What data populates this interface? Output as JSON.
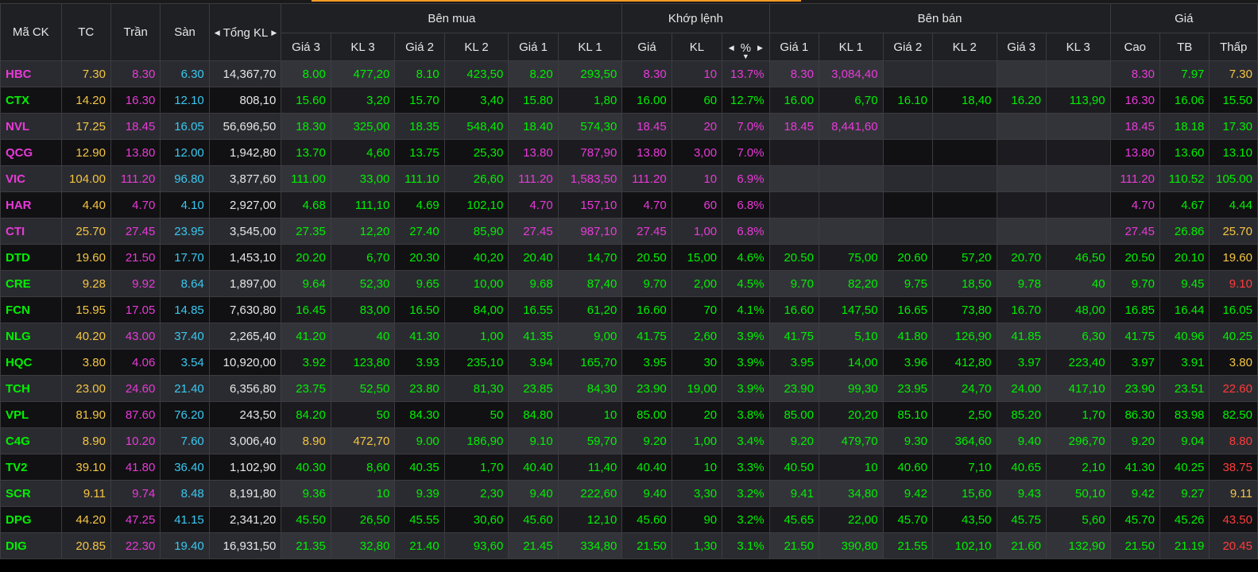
{
  "colors": {
    "ref": "#f5c542",
    "ceiling": "#e83ad8",
    "floor": "#39c8f0",
    "up": "#00f000",
    "down": "#ff3b3b",
    "neutral": "#e6e6e6"
  },
  "header": {
    "symbol": "Mã CK",
    "ref": "TC",
    "ceiling": "Trần",
    "floor": "Sàn",
    "total_volume": "Tổng KL",
    "buy_side": "Bên mua",
    "matched": "Khớp lệnh",
    "sell_side": "Bên bán",
    "price_group": "Giá",
    "bid3": "Giá 3",
    "bid3_vol": "KL 3",
    "bid2": "Giá 2",
    "bid2_vol": "KL 2",
    "bid1": "Giá 1",
    "bid1_vol": "KL 1",
    "match_price": "Giá",
    "match_vol": "KL",
    "match_pct": "%",
    "ask1": "Giá 1",
    "ask1_vol": "KL 1",
    "ask2": "Giá 2",
    "ask2_vol": "KL 2",
    "ask3": "Giá 3",
    "ask3_vol": "KL 3",
    "high": "Cao",
    "avg": "TB",
    "low": "Thấp"
  },
  "rows": [
    {
      "sym": "HBC",
      "tc": "7.30",
      "tran": "8.30",
      "san": "6.30",
      "tkl": "14,367,70",
      "g3": "8.00",
      "kl3": "477,20",
      "g2": "8.10",
      "kl2": "423,50",
      "g1": "8.20",
      "kl1": "293,50",
      "mp": "8.30",
      "mv": "10",
      "pct": "13.7%",
      "a1": "8.30",
      "av1": "3,084,40",
      "a2": "",
      "av2": "",
      "a3": "",
      "av3": "",
      "cao": "8.30",
      "tb": "7.97",
      "thap": "7.30",
      "c": {
        "sym": "ceiling",
        "g3": "up",
        "kl3": "up",
        "g2": "up",
        "kl2": "up",
        "g1": "up",
        "kl1": "up",
        "mp": "ceiling",
        "mv": "ceiling",
        "pct": "ceiling",
        "a1": "ceiling",
        "av1": "ceiling",
        "a2": "up",
        "av2": "up",
        "a3": "up",
        "av3": "up",
        "cao": "ceiling",
        "tb": "up",
        "thap": "ref"
      }
    },
    {
      "sym": "CTX",
      "tc": "14.20",
      "tran": "16.30",
      "san": "12.10",
      "tkl": "808,10",
      "g3": "15.60",
      "kl3": "3,20",
      "g2": "15.70",
      "kl2": "3,40",
      "g1": "15.80",
      "kl1": "1,80",
      "mp": "16.00",
      "mv": "60",
      "pct": "12.7%",
      "a1": "16.00",
      "av1": "6,70",
      "a2": "16.10",
      "av2": "18,40",
      "a3": "16.20",
      "av3": "113,90",
      "cao": "16.30",
      "tb": "16.06",
      "thap": "15.50",
      "c": {
        "sym": "up",
        "g3": "up",
        "kl3": "up",
        "g2": "up",
        "kl2": "up",
        "g1": "up",
        "kl1": "up",
        "mp": "up",
        "mv": "up",
        "pct": "up",
        "a1": "up",
        "av1": "up",
        "a2": "up",
        "av2": "up",
        "a3": "up",
        "av3": "up",
        "cao": "ceiling",
        "tb": "up",
        "thap": "up"
      }
    },
    {
      "sym": "NVL",
      "tc": "17.25",
      "tran": "18.45",
      "san": "16.05",
      "tkl": "56,696,50",
      "g3": "18.30",
      "kl3": "325,00",
      "g2": "18.35",
      "kl2": "548,40",
      "g1": "18.40",
      "kl1": "574,30",
      "mp": "18.45",
      "mv": "20",
      "pct": "7.0%",
      "a1": "18.45",
      "av1": "8,441,60",
      "a2": "",
      "av2": "",
      "a3": "",
      "av3": "",
      "cao": "18.45",
      "tb": "18.18",
      "thap": "17.30",
      "c": {
        "sym": "ceiling",
        "g3": "up",
        "kl3": "up",
        "g2": "up",
        "kl2": "up",
        "g1": "up",
        "kl1": "up",
        "mp": "ceiling",
        "mv": "ceiling",
        "pct": "ceiling",
        "a1": "ceiling",
        "av1": "ceiling",
        "a2": "up",
        "av2": "up",
        "a3": "up",
        "av3": "up",
        "cao": "ceiling",
        "tb": "up",
        "thap": "up"
      }
    },
    {
      "sym": "QCG",
      "tc": "12.90",
      "tran": "13.80",
      "san": "12.00",
      "tkl": "1,942,80",
      "g3": "13.70",
      "kl3": "4,60",
      "g2": "13.75",
      "kl2": "25,30",
      "g1": "13.80",
      "kl1": "787,90",
      "mp": "13.80",
      "mv": "3,00",
      "pct": "7.0%",
      "a1": "",
      "av1": "",
      "a2": "",
      "av2": "",
      "a3": "",
      "av3": "",
      "cao": "13.80",
      "tb": "13.60",
      "thap": "13.10",
      "c": {
        "sym": "ceiling",
        "g3": "up",
        "kl3": "up",
        "g2": "up",
        "kl2": "up",
        "g1": "ceiling",
        "kl1": "ceiling",
        "mp": "ceiling",
        "mv": "ceiling",
        "pct": "ceiling",
        "a1": "up",
        "av1": "up",
        "a2": "up",
        "av2": "up",
        "a3": "up",
        "av3": "up",
        "cao": "ceiling",
        "tb": "up",
        "thap": "up"
      }
    },
    {
      "sym": "VIC",
      "tc": "104.00",
      "tran": "111.20",
      "san": "96.80",
      "tkl": "3,877,60",
      "g3": "111.00",
      "kl3": "33,00",
      "g2": "111.10",
      "kl2": "26,60",
      "g1": "111.20",
      "kl1": "1,583,50",
      "mp": "111.20",
      "mv": "10",
      "pct": "6.9%",
      "a1": "",
      "av1": "",
      "a2": "",
      "av2": "",
      "a3": "",
      "av3": "",
      "cao": "111.20",
      "tb": "110.52",
      "thap": "105.00",
      "c": {
        "sym": "ceiling",
        "g3": "up",
        "kl3": "up",
        "g2": "up",
        "kl2": "up",
        "g1": "ceiling",
        "kl1": "ceiling",
        "mp": "ceiling",
        "mv": "ceiling",
        "pct": "ceiling",
        "a1": "up",
        "av1": "up",
        "a2": "up",
        "av2": "up",
        "a3": "up",
        "av3": "up",
        "cao": "ceiling",
        "tb": "up",
        "thap": "up"
      }
    },
    {
      "sym": "HAR",
      "tc": "4.40",
      "tran": "4.70",
      "san": "4.10",
      "tkl": "2,927,00",
      "g3": "4.68",
      "kl3": "111,10",
      "g2": "4.69",
      "kl2": "102,10",
      "g1": "4.70",
      "kl1": "157,10",
      "mp": "4.70",
      "mv": "60",
      "pct": "6.8%",
      "a1": "",
      "av1": "",
      "a2": "",
      "av2": "",
      "a3": "",
      "av3": "",
      "cao": "4.70",
      "tb": "4.67",
      "thap": "4.44",
      "c": {
        "sym": "ceiling",
        "g3": "up",
        "kl3": "up",
        "g2": "up",
        "kl2": "up",
        "g1": "ceiling",
        "kl1": "ceiling",
        "mp": "ceiling",
        "mv": "ceiling",
        "pct": "ceiling",
        "a1": "up",
        "av1": "up",
        "a2": "up",
        "av2": "up",
        "a3": "up",
        "av3": "up",
        "cao": "ceiling",
        "tb": "up",
        "thap": "up"
      }
    },
    {
      "sym": "CTI",
      "tc": "25.70",
      "tran": "27.45",
      "san": "23.95",
      "tkl": "3,545,00",
      "g3": "27.35",
      "kl3": "12,20",
      "g2": "27.40",
      "kl2": "85,90",
      "g1": "27.45",
      "kl1": "987,10",
      "mp": "27.45",
      "mv": "1,00",
      "pct": "6.8%",
      "a1": "",
      "av1": "",
      "a2": "",
      "av2": "",
      "a3": "",
      "av3": "",
      "cao": "27.45",
      "tb": "26.86",
      "thap": "25.70",
      "c": {
        "sym": "ceiling",
        "g3": "up",
        "kl3": "up",
        "g2": "up",
        "kl2": "up",
        "g1": "ceiling",
        "kl1": "ceiling",
        "mp": "ceiling",
        "mv": "ceiling",
        "pct": "ceiling",
        "a1": "up",
        "av1": "up",
        "a2": "up",
        "av2": "up",
        "a3": "up",
        "av3": "up",
        "cao": "ceiling",
        "tb": "up",
        "thap": "ref"
      }
    },
    {
      "sym": "DTD",
      "tc": "19.60",
      "tran": "21.50",
      "san": "17.70",
      "tkl": "1,453,10",
      "g3": "20.20",
      "kl3": "6,70",
      "g2": "20.30",
      "kl2": "40,20",
      "g1": "20.40",
      "kl1": "14,70",
      "mp": "20.50",
      "mv": "15,00",
      "pct": "4.6%",
      "a1": "20.50",
      "av1": "75,00",
      "a2": "20.60",
      "av2": "57,20",
      "a3": "20.70",
      "av3": "46,50",
      "cao": "20.50",
      "tb": "20.10",
      "thap": "19.60",
      "c": {
        "sym": "up",
        "g3": "up",
        "kl3": "up",
        "g2": "up",
        "kl2": "up",
        "g1": "up",
        "kl1": "up",
        "mp": "up",
        "mv": "up",
        "pct": "up",
        "a1": "up",
        "av1": "up",
        "a2": "up",
        "av2": "up",
        "a3": "up",
        "av3": "up",
        "cao": "up",
        "tb": "up",
        "thap": "ref"
      }
    },
    {
      "sym": "CRE",
      "tc": "9.28",
      "tran": "9.92",
      "san": "8.64",
      "tkl": "1,897,00",
      "g3": "9.64",
      "kl3": "52,30",
      "g2": "9.65",
      "kl2": "10,00",
      "g1": "9.68",
      "kl1": "87,40",
      "mp": "9.70",
      "mv": "2,00",
      "pct": "4.5%",
      "a1": "9.70",
      "av1": "82,20",
      "a2": "9.75",
      "av2": "18,50",
      "a3": "9.78",
      "av3": "40",
      "cao": "9.70",
      "tb": "9.45",
      "thap": "9.10",
      "c": {
        "sym": "up",
        "g3": "up",
        "kl3": "up",
        "g2": "up",
        "kl2": "up",
        "g1": "up",
        "kl1": "up",
        "mp": "up",
        "mv": "up",
        "pct": "up",
        "a1": "up",
        "av1": "up",
        "a2": "up",
        "av2": "up",
        "a3": "up",
        "av3": "up",
        "cao": "up",
        "tb": "up",
        "thap": "down"
      }
    },
    {
      "sym": "FCN",
      "tc": "15.95",
      "tran": "17.05",
      "san": "14.85",
      "tkl": "7,630,80",
      "g3": "16.45",
      "kl3": "83,00",
      "g2": "16.50",
      "kl2": "84,00",
      "g1": "16.55",
      "kl1": "61,20",
      "mp": "16.60",
      "mv": "70",
      "pct": "4.1%",
      "a1": "16.60",
      "av1": "147,50",
      "a2": "16.65",
      "av2": "73,80",
      "a3": "16.70",
      "av3": "48,00",
      "cao": "16.85",
      "tb": "16.44",
      "thap": "16.05",
      "c": {
        "sym": "up",
        "g3": "up",
        "kl3": "up",
        "g2": "up",
        "kl2": "up",
        "g1": "up",
        "kl1": "up",
        "mp": "up",
        "mv": "up",
        "pct": "up",
        "a1": "up",
        "av1": "up",
        "a2": "up",
        "av2": "up",
        "a3": "up",
        "av3": "up",
        "cao": "up",
        "tb": "up",
        "thap": "up"
      }
    },
    {
      "sym": "NLG",
      "tc": "40.20",
      "tran": "43.00",
      "san": "37.40",
      "tkl": "2,265,40",
      "g3": "41.20",
      "kl3": "40",
      "g2": "41.30",
      "kl2": "1,00",
      "g1": "41.35",
      "kl1": "9,00",
      "mp": "41.75",
      "mv": "2,60",
      "pct": "3.9%",
      "a1": "41.75",
      "av1": "5,10",
      "a2": "41.80",
      "av2": "126,90",
      "a3": "41.85",
      "av3": "6,30",
      "cao": "41.75",
      "tb": "40.96",
      "thap": "40.25",
      "c": {
        "sym": "up",
        "g3": "up",
        "kl3": "up",
        "g2": "up",
        "kl2": "up",
        "g1": "up",
        "kl1": "up",
        "mp": "up",
        "mv": "up",
        "pct": "up",
        "a1": "up",
        "av1": "up",
        "a2": "up",
        "av2": "up",
        "a3": "up",
        "av3": "up",
        "cao": "up",
        "tb": "up",
        "thap": "up"
      }
    },
    {
      "sym": "HQC",
      "tc": "3.80",
      "tran": "4.06",
      "san": "3.54",
      "tkl": "10,920,00",
      "g3": "3.92",
      "kl3": "123,80",
      "g2": "3.93",
      "kl2": "235,10",
      "g1": "3.94",
      "kl1": "165,70",
      "mp": "3.95",
      "mv": "30",
      "pct": "3.9%",
      "a1": "3.95",
      "av1": "14,00",
      "a2": "3.96",
      "av2": "412,80",
      "a3": "3.97",
      "av3": "223,40",
      "cao": "3.97",
      "tb": "3.91",
      "thap": "3.80",
      "c": {
        "sym": "up",
        "g3": "up",
        "kl3": "up",
        "g2": "up",
        "kl2": "up",
        "g1": "up",
        "kl1": "up",
        "mp": "up",
        "mv": "up",
        "pct": "up",
        "a1": "up",
        "av1": "up",
        "a2": "up",
        "av2": "up",
        "a3": "up",
        "av3": "up",
        "cao": "up",
        "tb": "up",
        "thap": "ref"
      }
    },
    {
      "sym": "TCH",
      "tc": "23.00",
      "tran": "24.60",
      "san": "21.40",
      "tkl": "6,356,80",
      "g3": "23.75",
      "kl3": "52,50",
      "g2": "23.80",
      "kl2": "81,30",
      "g1": "23.85",
      "kl1": "84,30",
      "mp": "23.90",
      "mv": "19,00",
      "pct": "3.9%",
      "a1": "23.90",
      "av1": "99,30",
      "a2": "23.95",
      "av2": "24,70",
      "a3": "24.00",
      "av3": "417,10",
      "cao": "23.90",
      "tb": "23.51",
      "thap": "22.60",
      "c": {
        "sym": "up",
        "g3": "up",
        "kl3": "up",
        "g2": "up",
        "kl2": "up",
        "g1": "up",
        "kl1": "up",
        "mp": "up",
        "mv": "up",
        "pct": "up",
        "a1": "up",
        "av1": "up",
        "a2": "up",
        "av2": "up",
        "a3": "up",
        "av3": "up",
        "cao": "up",
        "tb": "up",
        "thap": "down"
      }
    },
    {
      "sym": "VPL",
      "tc": "81.90",
      "tran": "87.60",
      "san": "76.20",
      "tkl": "243,50",
      "g3": "84.20",
      "kl3": "50",
      "g2": "84.30",
      "kl2": "50",
      "g1": "84.80",
      "kl1": "10",
      "mp": "85.00",
      "mv": "20",
      "pct": "3.8%",
      "a1": "85.00",
      "av1": "20,20",
      "a2": "85.10",
      "av2": "2,50",
      "a3": "85.20",
      "av3": "1,70",
      "cao": "86.30",
      "tb": "83.98",
      "thap": "82.50",
      "c": {
        "sym": "up",
        "g3": "up",
        "kl3": "up",
        "g2": "up",
        "kl2": "up",
        "g1": "up",
        "kl1": "up",
        "mp": "up",
        "mv": "up",
        "pct": "up",
        "a1": "up",
        "av1": "up",
        "a2": "up",
        "av2": "up",
        "a3": "up",
        "av3": "up",
        "cao": "up",
        "tb": "up",
        "thap": "up"
      }
    },
    {
      "sym": "C4G",
      "tc": "8.90",
      "tran": "10.20",
      "san": "7.60",
      "tkl": "3,006,40",
      "g3": "8.90",
      "kl3": "472,70",
      "g2": "9.00",
      "kl2": "186,90",
      "g1": "9.10",
      "kl1": "59,70",
      "mp": "9.20",
      "mv": "1,00",
      "pct": "3.4%",
      "a1": "9.20",
      "av1": "479,70",
      "a2": "9.30",
      "av2": "364,60",
      "a3": "9.40",
      "av3": "296,70",
      "cao": "9.20",
      "tb": "9.04",
      "thap": "8.80",
      "c": {
        "sym": "up",
        "g3": "ref",
        "kl3": "ref",
        "g2": "up",
        "kl2": "up",
        "g1": "up",
        "kl1": "up",
        "mp": "up",
        "mv": "up",
        "pct": "up",
        "a1": "up",
        "av1": "up",
        "a2": "up",
        "av2": "up",
        "a3": "up",
        "av3": "up",
        "cao": "up",
        "tb": "up",
        "thap": "down"
      }
    },
    {
      "sym": "TV2",
      "tc": "39.10",
      "tran": "41.80",
      "san": "36.40",
      "tkl": "1,102,90",
      "g3": "40.30",
      "kl3": "8,60",
      "g2": "40.35",
      "kl2": "1,70",
      "g1": "40.40",
      "kl1": "11,40",
      "mp": "40.40",
      "mv": "10",
      "pct": "3.3%",
      "a1": "40.50",
      "av1": "10",
      "a2": "40.60",
      "av2": "7,10",
      "a3": "40.65",
      "av3": "2,10",
      "cao": "41.30",
      "tb": "40.25",
      "thap": "38.75",
      "c": {
        "sym": "up",
        "g3": "up",
        "kl3": "up",
        "g2": "up",
        "kl2": "up",
        "g1": "up",
        "kl1": "up",
        "mp": "up",
        "mv": "up",
        "pct": "up",
        "a1": "up",
        "av1": "up",
        "a2": "up",
        "av2": "up",
        "a3": "up",
        "av3": "up",
        "cao": "up",
        "tb": "up",
        "thap": "down"
      }
    },
    {
      "sym": "SCR",
      "tc": "9.11",
      "tran": "9.74",
      "san": "8.48",
      "tkl": "8,191,80",
      "g3": "9.36",
      "kl3": "10",
      "g2": "9.39",
      "kl2": "2,30",
      "g1": "9.40",
      "kl1": "222,60",
      "mp": "9.40",
      "mv": "3,30",
      "pct": "3.2%",
      "a1": "9.41",
      "av1": "34,80",
      "a2": "9.42",
      "av2": "15,60",
      "a3": "9.43",
      "av3": "50,10",
      "cao": "9.42",
      "tb": "9.27",
      "thap": "9.11",
      "c": {
        "sym": "up",
        "g3": "up",
        "kl3": "up",
        "g2": "up",
        "kl2": "up",
        "g1": "up",
        "kl1": "up",
        "mp": "up",
        "mv": "up",
        "pct": "up",
        "a1": "up",
        "av1": "up",
        "a2": "up",
        "av2": "up",
        "a3": "up",
        "av3": "up",
        "cao": "up",
        "tb": "up",
        "thap": "ref"
      }
    },
    {
      "sym": "DPG",
      "tc": "44.20",
      "tran": "47.25",
      "san": "41.15",
      "tkl": "2,341,20",
      "g3": "45.50",
      "kl3": "26,50",
      "g2": "45.55",
      "kl2": "30,60",
      "g1": "45.60",
      "kl1": "12,10",
      "mp": "45.60",
      "mv": "90",
      "pct": "3.2%",
      "a1": "45.65",
      "av1": "22,00",
      "a2": "45.70",
      "av2": "43,50",
      "a3": "45.75",
      "av3": "5,60",
      "cao": "45.70",
      "tb": "45.26",
      "thap": "43.50",
      "c": {
        "sym": "up",
        "g3": "up",
        "kl3": "up",
        "g2": "up",
        "kl2": "up",
        "g1": "up",
        "kl1": "up",
        "mp": "up",
        "mv": "up",
        "pct": "up",
        "a1": "up",
        "av1": "up",
        "a2": "up",
        "av2": "up",
        "a3": "up",
        "av3": "up",
        "cao": "up",
        "tb": "up",
        "thap": "down"
      }
    },
    {
      "sym": "DIG",
      "tc": "20.85",
      "tran": "22.30",
      "san": "19.40",
      "tkl": "16,931,50",
      "g3": "21.35",
      "kl3": "32,80",
      "g2": "21.40",
      "kl2": "93,60",
      "g1": "21.45",
      "kl1": "334,80",
      "mp": "21.50",
      "mv": "1,30",
      "pct": "3.1%",
      "a1": "21.50",
      "av1": "390,80",
      "a2": "21.55",
      "av2": "102,10",
      "a3": "21.60",
      "av3": "132,90",
      "cao": "21.50",
      "tb": "21.19",
      "thap": "20.45",
      "c": {
        "sym": "up",
        "g3": "up",
        "kl3": "up",
        "g2": "up",
        "kl2": "up",
        "g1": "up",
        "kl1": "up",
        "mp": "up",
        "mv": "up",
        "pct": "up",
        "a1": "up",
        "av1": "up",
        "a2": "up",
        "av2": "up",
        "a3": "up",
        "av3": "up",
        "cao": "up",
        "tb": "up",
        "thap": "down"
      }
    }
  ]
}
